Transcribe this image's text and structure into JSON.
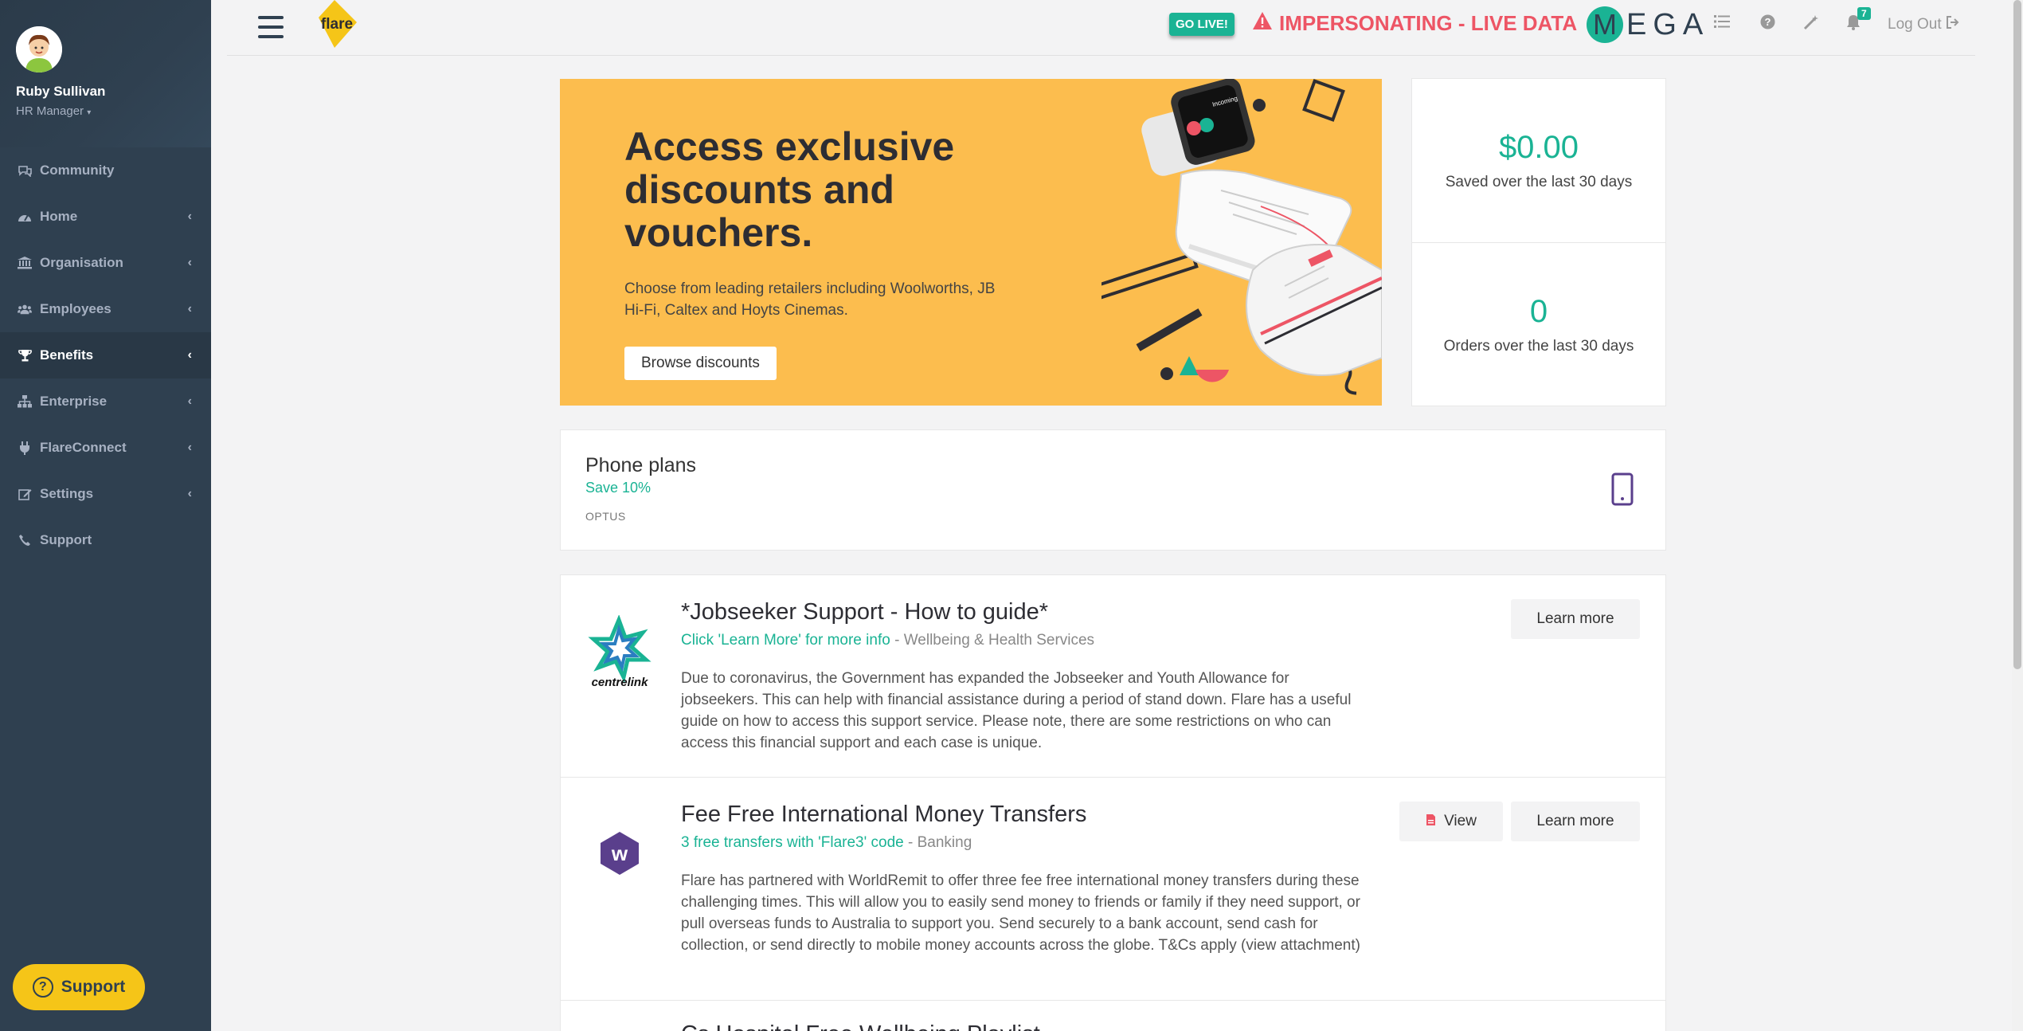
{
  "user": {
    "name": "Ruby Sullivan",
    "role": "HR Manager"
  },
  "sidebar": {
    "items": [
      {
        "label": "Community",
        "icon": "comments-icon",
        "has_children": false,
        "active": false
      },
      {
        "label": "Home",
        "icon": "dashboard-icon",
        "has_children": true,
        "active": false
      },
      {
        "label": "Organisation",
        "icon": "bank-icon",
        "has_children": true,
        "active": false
      },
      {
        "label": "Employees",
        "icon": "users-icon",
        "has_children": true,
        "active": false
      },
      {
        "label": "Benefits",
        "icon": "trophy-icon",
        "has_children": true,
        "active": true
      },
      {
        "label": "Enterprise",
        "icon": "sitemap-icon",
        "has_children": true,
        "active": false
      },
      {
        "label": "FlareConnect",
        "icon": "plug-icon",
        "has_children": true,
        "active": false
      },
      {
        "label": "Settings",
        "icon": "edit-icon",
        "has_children": true,
        "active": false
      },
      {
        "label": "Support",
        "icon": "phone-icon",
        "has_children": false,
        "active": false
      }
    ],
    "support_button": "Support"
  },
  "topbar": {
    "logo_text": "flare",
    "go_live": "GO LIVE!",
    "impersonating": "IMPERSONATING - LIVE DATA",
    "brand_m": "M",
    "brand_rest": "EGA",
    "notification_count": "7",
    "logout": "Log Out"
  },
  "banner": {
    "title": "Access exclusive discounts and vouchers.",
    "description": "Choose from leading retailers including Woolworths, JB Hi-Fi, Caltex and Hoyts Cinemas.",
    "button": "Browse discounts"
  },
  "stats": {
    "saved_value": "$0.00",
    "saved_label": "Saved over the last 30 days",
    "orders_value": "0",
    "orders_label": "Orders over the last 30 days"
  },
  "phone_plan": {
    "title": "Phone plans",
    "saving": "Save 10%",
    "provider": "OPTUS"
  },
  "offers": [
    {
      "title": "*Jobseeker Support - How to guide*",
      "highlight": "Click 'Learn More' for more info",
      "separator": " - ",
      "category": "Wellbeing & Health Services",
      "description": "Due to coronavirus, the Government has expanded the Jobseeker and Youth Allowance for jobseekers. This can help with financial assistance during a period of stand down. Flare has a useful guide on how to access this support service. Please note, there are some restrictions on who can access this financial support and each case is unique.",
      "logo_text": "centrelink",
      "learn_more": "Learn more"
    },
    {
      "title": "Fee Free International Money Transfers",
      "highlight": "3 free transfers with 'Flare3' code",
      "separator": " - ",
      "category": "Banking",
      "description": "Flare has partnered with WorldRemit to offer three fee free international money transfers during these challenging times. This will allow you to easily send money to friends or family if they need support, or pull overseas funds to Australia to support you. Send securely to a bank account, send cash for collection, or send directly to mobile money accounts across the globe. T&Cs apply (view attachment)",
      "logo_text": "w",
      "view": "View",
      "learn_more": "Learn more"
    },
    {
      "title": "Cs Hospital Free Wellbeing Playlist"
    }
  ],
  "colors": {
    "accent": "#1ab394",
    "sidebar": "#2f4050",
    "banner": "#fcbd4e",
    "alert": "#ed5565"
  }
}
